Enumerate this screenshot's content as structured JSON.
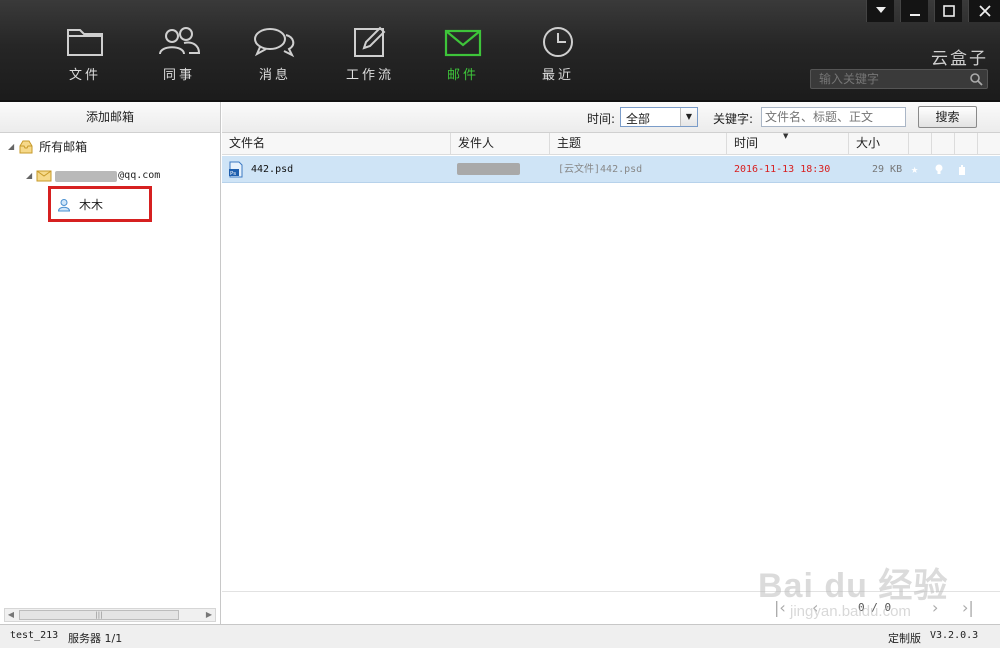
{
  "nav": {
    "items": [
      {
        "label": "文件",
        "icon": "folder-icon"
      },
      {
        "label": "同事",
        "icon": "contacts-icon"
      },
      {
        "label": "消息",
        "icon": "chat-icon"
      },
      {
        "label": "工作流",
        "icon": "edit-icon"
      },
      {
        "label": "邮件",
        "icon": "mail-icon",
        "active": true
      },
      {
        "label": "最近",
        "icon": "clock-icon"
      }
    ],
    "accent_color": "#3ec43a"
  },
  "window_controls": {
    "menu": "▼",
    "minimize": "—",
    "maximize": "□",
    "close": "✕"
  },
  "brand": "云盒子",
  "top_search": {
    "placeholder": "输入关键字"
  },
  "sidebar": {
    "add_mailbox": "添加邮箱",
    "all_mailboxes": "所有邮箱",
    "account_suffix": "@qq.com",
    "contact": "木木"
  },
  "filter": {
    "time_label": "时间:",
    "time_value": "全部",
    "keyword_label": "关键字:",
    "keyword_placeholder": "文件名、标题、正文",
    "search_button": "搜索"
  },
  "table": {
    "columns": [
      "文件名",
      "发件人",
      "主题",
      "时间",
      "大小"
    ],
    "rows": [
      {
        "file": "442.psd",
        "subject": "[云文件]442.psd",
        "time": "2016-11-13 18:30",
        "size": "29 KB"
      }
    ]
  },
  "pager": {
    "text": "0 / 0"
  },
  "watermark": {
    "logo": "Bai du 经验",
    "url": "jingyan.baidu.com"
  },
  "status": {
    "user": "test_213",
    "server": "服务器 1/1",
    "edition": "定制版",
    "version": "V3.2.0.3"
  }
}
